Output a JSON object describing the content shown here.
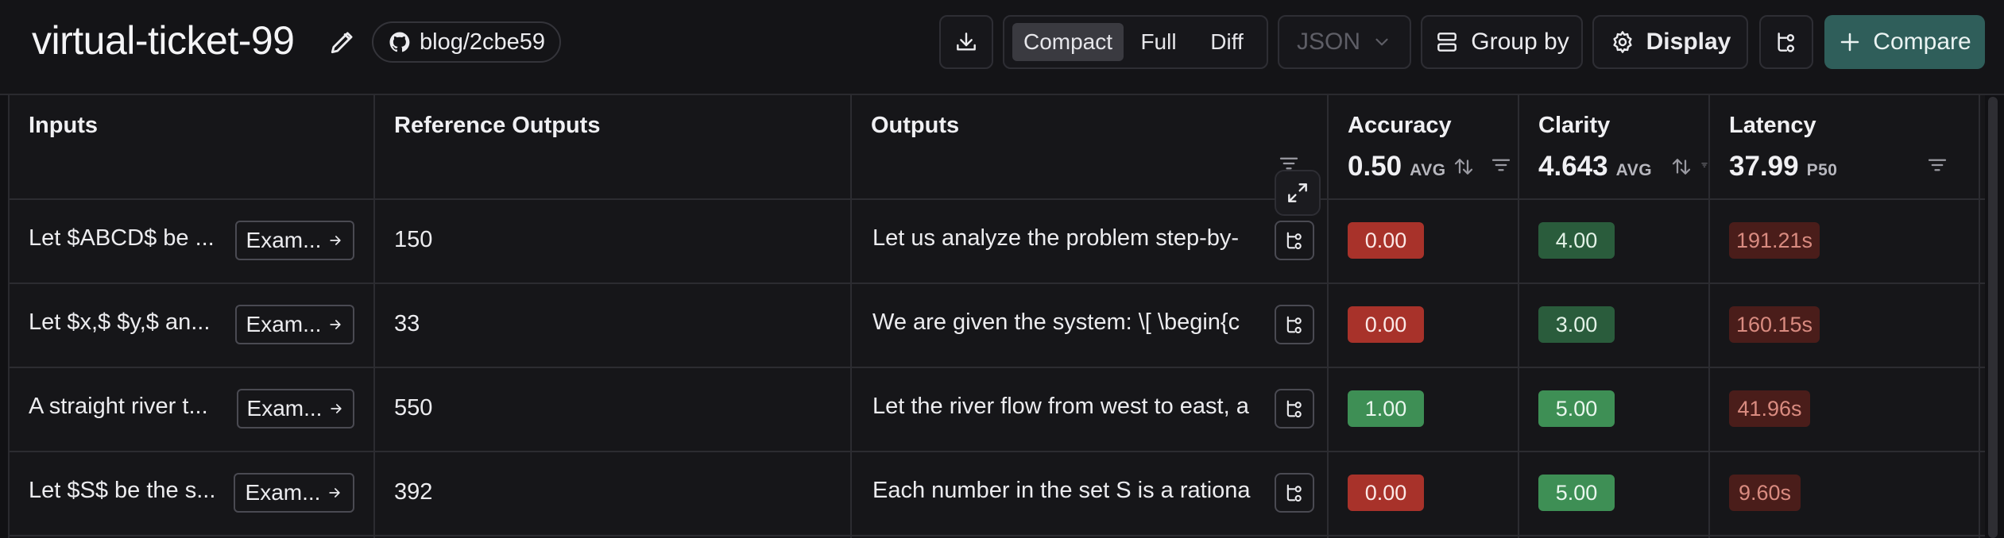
{
  "header": {
    "title": "virtual-ticket-99",
    "branch_chip": "blog/2cbe59",
    "view_modes": [
      "Compact",
      "Full",
      "Diff"
    ],
    "active_view_mode": "Compact",
    "format_select": "JSON",
    "group_by_label": "Group by",
    "display_label": "Display",
    "compare_label": "Compare"
  },
  "table": {
    "columns": {
      "inputs": "Inputs",
      "reference_outputs": "Reference Outputs",
      "outputs": "Outputs",
      "accuracy": {
        "label": "Accuracy",
        "value": "0.50",
        "unit": "AVG"
      },
      "clarity": {
        "label": "Clarity",
        "value": "4.643",
        "unit": "AVG"
      },
      "latency": {
        "label": "Latency",
        "value": "37.99",
        "unit": "P50"
      }
    },
    "example_label": "Exam...",
    "rows": [
      {
        "input": "Let $ABCD$ be ...",
        "reference": "150",
        "output": "Let us analyze the problem step-by-",
        "accuracy": "0.00",
        "clarity": "4.00",
        "latency": "191.21s"
      },
      {
        "input": "Let $x,$ $y,$ an...",
        "reference": "33",
        "output": "We are given the system: \\[ \\begin{c",
        "accuracy": "0.00",
        "clarity": "3.00",
        "latency": "160.15s"
      },
      {
        "input": "A straight river t...",
        "reference": "550",
        "output": "Let the river flow from west to east, a",
        "accuracy": "1.00",
        "clarity": "5.00",
        "latency": "41.96s"
      },
      {
        "input": "Let $S$ be the s...",
        "reference": "392",
        "output": "Each number in the set S is a rationa",
        "accuracy": "0.00",
        "clarity": "5.00",
        "latency": "9.60s"
      }
    ]
  },
  "colors": {
    "accuracy_fail": "#a8322a",
    "accuracy_pass": "#3e8f55",
    "clarity_mid": "#2a5c3c",
    "clarity_high": "#3e8f55",
    "latency_bg": "#4a1d1a",
    "compare_button": "#2f5e5a"
  },
  "icons": [
    "pencil-icon",
    "github-icon",
    "download-icon",
    "chevron-down-icon",
    "group-by-icon",
    "gear-icon",
    "trace-icon",
    "plus-icon",
    "filter-icon",
    "sort-icon",
    "expand-icon",
    "arrow-right-icon"
  ]
}
